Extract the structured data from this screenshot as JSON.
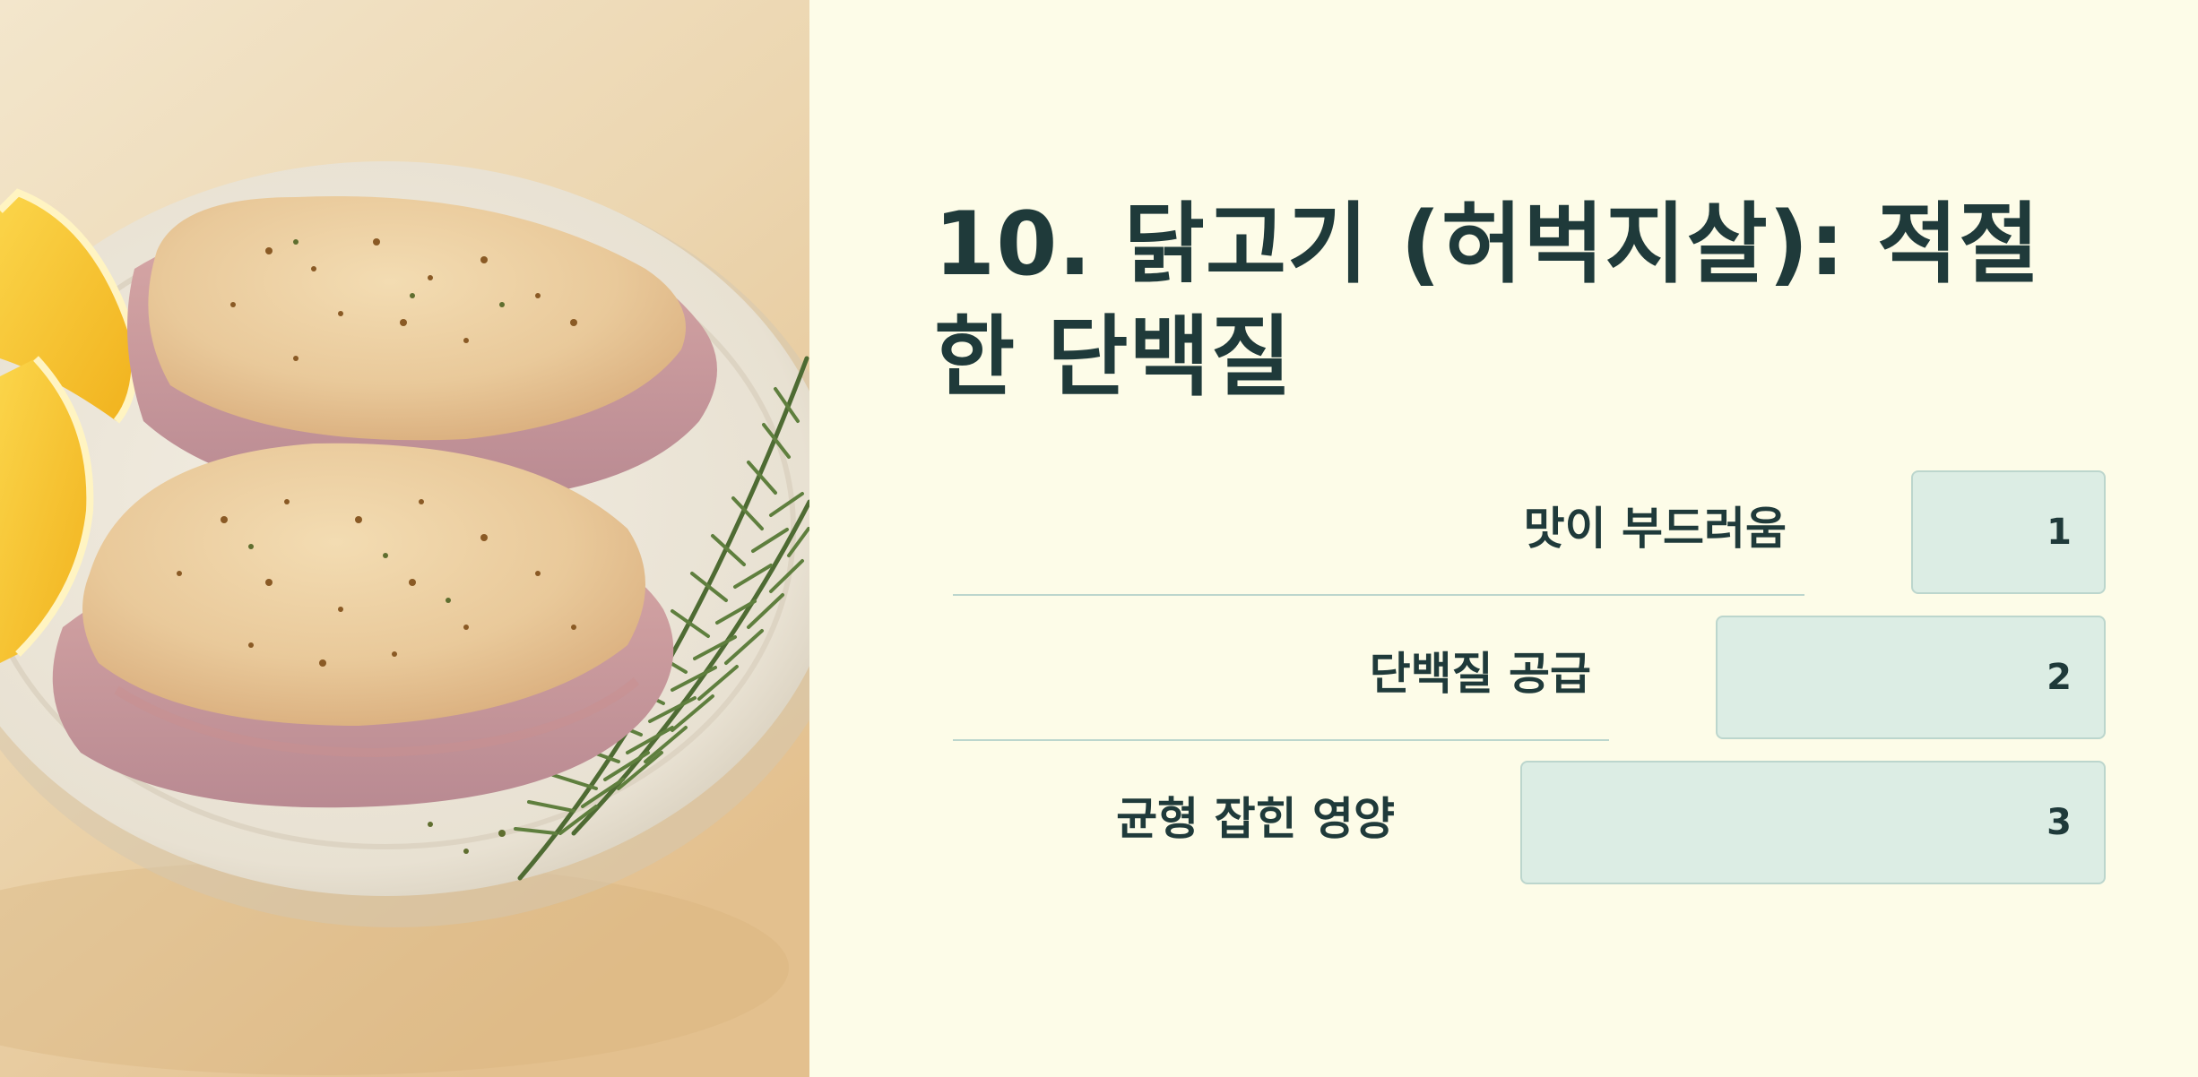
{
  "slide": {
    "title": "10. 닭고기 (허벅지살): 적절한 단백질"
  },
  "steps": [
    {
      "label": "맛이 부드러움",
      "number": "1"
    },
    {
      "label": "단백질 공급",
      "number": "2"
    },
    {
      "label": "균형 잡힌 영양",
      "number": "3"
    }
  ],
  "colors": {
    "background": "#fdfce8",
    "text": "#1f3a3a",
    "box_fill": "#dcede4",
    "box_border": "#bcd6cd"
  }
}
